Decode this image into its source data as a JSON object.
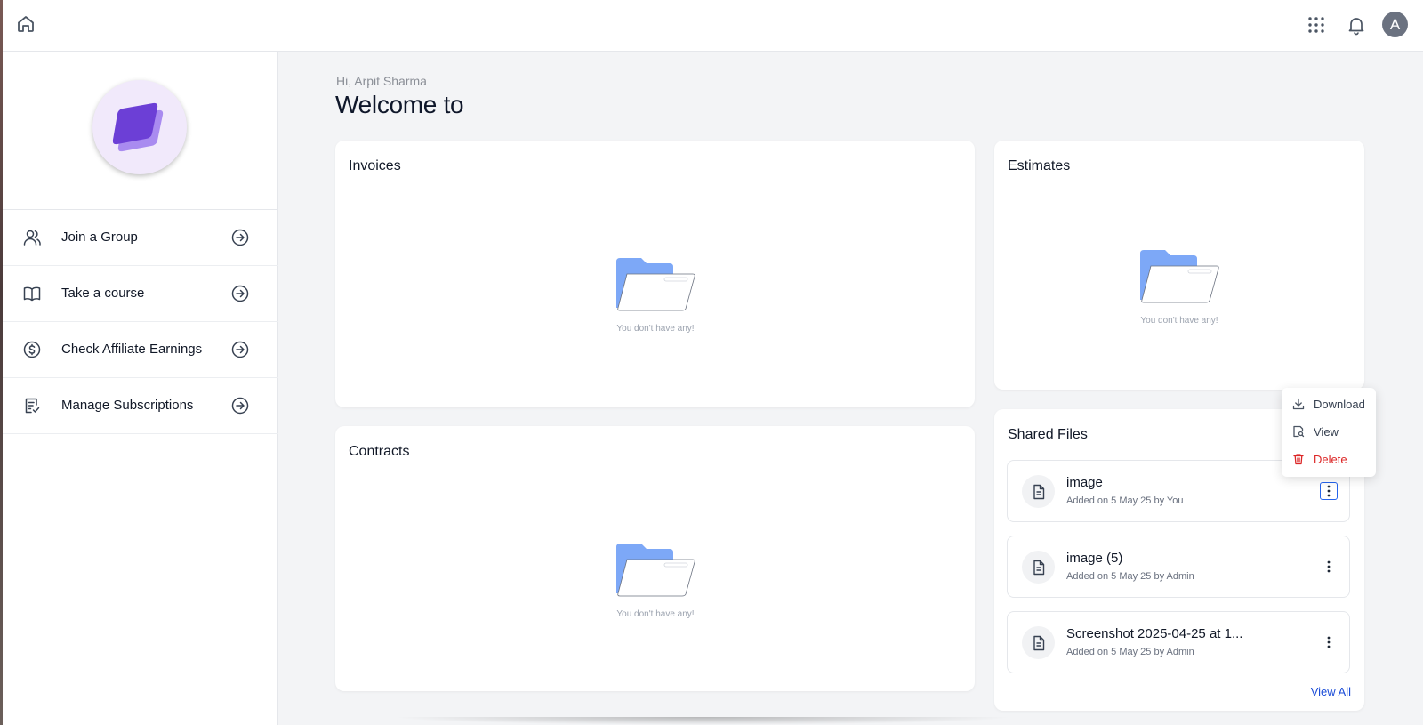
{
  "user": {
    "greeting": "Hi, Arpit Sharma",
    "avatar_initial": "A"
  },
  "main": {
    "welcome_title": "Welcome to"
  },
  "sidebar": {
    "items": [
      {
        "label": "Join a Group",
        "icon": "users-icon"
      },
      {
        "label": "Take a course",
        "icon": "book-icon"
      },
      {
        "label": "Check Affiliate Earnings",
        "icon": "dollar-icon"
      },
      {
        "label": "Manage Subscriptions",
        "icon": "receipt-icon"
      }
    ]
  },
  "cards": {
    "invoices": {
      "title": "Invoices",
      "empty_text": "You don't have any!"
    },
    "estimates": {
      "title": "Estimates",
      "empty_text": "You don't have any!"
    },
    "contracts": {
      "title": "Contracts",
      "empty_text": "You don't have any!"
    },
    "shared_files": {
      "title": "Shared Files",
      "view_all": "View All",
      "files": [
        {
          "name": "image",
          "meta": "Added on 5 May 25 by You"
        },
        {
          "name": "image (5)",
          "meta": "Added on 5 May 25 by Admin"
        },
        {
          "name": "Screenshot 2025-04-25 at 1...",
          "meta": "Added on 5 May 25 by Admin"
        }
      ]
    }
  },
  "file_menu": {
    "download": "Download",
    "view": "View",
    "delete": "Delete"
  },
  "colors": {
    "accent": "#2563eb",
    "danger": "#dc2626",
    "logo_purple": "#7c3aed",
    "folder_blue": "#7da8f7"
  }
}
